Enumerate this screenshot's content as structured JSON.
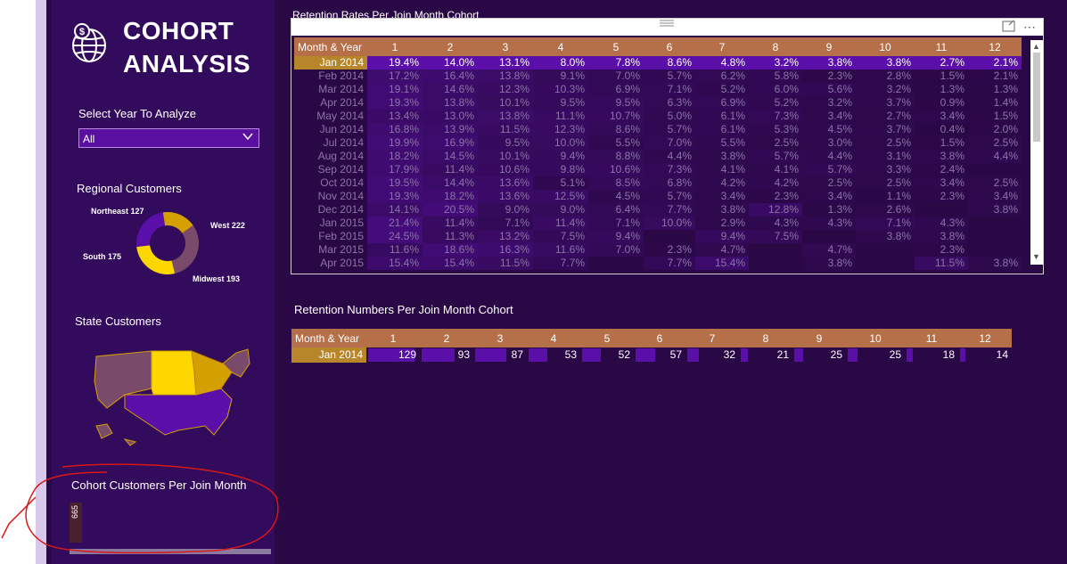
{
  "header": {
    "title_line1": "COHORT",
    "title_line2": "ANALYSIS"
  },
  "slicer": {
    "label": "Select Year To Analyze",
    "value": "All"
  },
  "regional": {
    "title": "Regional Customers",
    "segments": [
      {
        "name": "Northeast",
        "value": 127,
        "label": "Northeast 127",
        "color": "#d4a000"
      },
      {
        "name": "West",
        "value": 222,
        "label": "West 222",
        "color": "#7a4a6a"
      },
      {
        "name": "Midwest",
        "value": 193,
        "label": "Midwest 193",
        "color": "#ffd700"
      },
      {
        "name": "South",
        "value": 175,
        "label": "South 175",
        "color": "#5a10a8"
      }
    ]
  },
  "state": {
    "title": "State Customers"
  },
  "cohort": {
    "title": "Cohort Customers Per Join Month",
    "bar_value": 665,
    "bar_label": "665"
  },
  "matrix1": {
    "title": "Retention Rates Per Join Month Cohort",
    "row_header": "Month & Year",
    "columns": [
      "1",
      "2",
      "3",
      "4",
      "5",
      "6",
      "7",
      "8",
      "9",
      "10",
      "11",
      "12"
    ],
    "rows": [
      {
        "label": "Jan 2014",
        "cells": [
          "19.4%",
          "14.0%",
          "13.1%",
          "8.0%",
          "7.8%",
          "8.6%",
          "4.8%",
          "3.2%",
          "3.8%",
          "3.8%",
          "2.7%",
          "2.1%"
        ]
      },
      {
        "label": "Feb 2014",
        "cells": [
          "17.2%",
          "16.4%",
          "13.8%",
          "9.1%",
          "7.0%",
          "5.7%",
          "6.2%",
          "5.8%",
          "2.3%",
          "2.8%",
          "1.5%",
          "2.1%"
        ]
      },
      {
        "label": "Mar 2014",
        "cells": [
          "19.1%",
          "14.6%",
          "12.3%",
          "10.3%",
          "6.9%",
          "7.1%",
          "5.2%",
          "6.0%",
          "5.6%",
          "3.2%",
          "1.3%",
          "1.3%"
        ]
      },
      {
        "label": "Apr 2014",
        "cells": [
          "19.3%",
          "13.8%",
          "10.1%",
          "9.5%",
          "9.5%",
          "6.3%",
          "6.9%",
          "5.2%",
          "3.2%",
          "3.7%",
          "0.9%",
          "1.4%"
        ]
      },
      {
        "label": "May 2014",
        "cells": [
          "13.4%",
          "13.0%",
          "13.8%",
          "11.1%",
          "10.7%",
          "5.0%",
          "6.1%",
          "7.3%",
          "3.4%",
          "2.7%",
          "3.4%",
          "1.5%"
        ]
      },
      {
        "label": "Jun 2014",
        "cells": [
          "16.8%",
          "13.9%",
          "11.5%",
          "12.3%",
          "8.6%",
          "5.7%",
          "6.1%",
          "5.3%",
          "4.5%",
          "3.7%",
          "0.4%",
          "2.0%"
        ]
      },
      {
        "label": "Jul 2014",
        "cells": [
          "19.9%",
          "16.9%",
          "9.5%",
          "10.0%",
          "5.5%",
          "7.0%",
          "5.5%",
          "2.5%",
          "3.0%",
          "2.5%",
          "1.5%",
          "2.5%"
        ]
      },
      {
        "label": "Aug 2014",
        "cells": [
          "18.2%",
          "14.5%",
          "10.1%",
          "9.4%",
          "8.8%",
          "4.4%",
          "3.8%",
          "5.7%",
          "4.4%",
          "3.1%",
          "3.8%",
          "4.4%"
        ]
      },
      {
        "label": "Sep 2014",
        "cells": [
          "17.9%",
          "11.4%",
          "10.6%",
          "9.8%",
          "10.6%",
          "7.3%",
          "4.1%",
          "4.1%",
          "5.7%",
          "3.3%",
          "2.4%",
          ""
        ]
      },
      {
        "label": "Oct 2014",
        "cells": [
          "19.5%",
          "14.4%",
          "13.6%",
          "5.1%",
          "8.5%",
          "6.8%",
          "4.2%",
          "4.2%",
          "2.5%",
          "2.5%",
          "3.4%",
          "2.5%"
        ]
      },
      {
        "label": "Nov 2014",
        "cells": [
          "19.3%",
          "18.2%",
          "13.6%",
          "12.5%",
          "4.5%",
          "5.7%",
          "3.4%",
          "2.3%",
          "3.4%",
          "1.1%",
          "2.3%",
          "3.4%"
        ]
      },
      {
        "label": "Dec 2014",
        "cells": [
          "14.1%",
          "20.5%",
          "9.0%",
          "9.0%",
          "6.4%",
          "7.7%",
          "3.8%",
          "12.8%",
          "1.3%",
          "2.6%",
          "",
          "3.8%"
        ]
      },
      {
        "label": "Jan 2015",
        "cells": [
          "21.4%",
          "11.4%",
          "7.1%",
          "11.4%",
          "7.1%",
          "10.0%",
          "2.9%",
          "4.3%",
          "4.3%",
          "7.1%",
          "4.3%",
          ""
        ]
      },
      {
        "label": "Feb 2015",
        "cells": [
          "24.5%",
          "11.3%",
          "13.2%",
          "7.5%",
          "9.4%",
          "",
          "9.4%",
          "7.5%",
          "",
          "3.8%",
          "3.8%",
          ""
        ]
      },
      {
        "label": "Mar 2015",
        "cells": [
          "11.6%",
          "18.6%",
          "16.3%",
          "11.6%",
          "7.0%",
          "2.3%",
          "4.7%",
          "",
          "4.7%",
          "",
          "2.3%",
          ""
        ]
      },
      {
        "label": "Apr 2015",
        "cells": [
          "15.4%",
          "15.4%",
          "11.5%",
          "7.7%",
          "",
          "7.7%",
          "15.4%",
          "",
          "3.8%",
          "",
          "11.5%",
          "3.8%"
        ]
      }
    ]
  },
  "matrix2": {
    "title": "Retention Numbers Per Join Month Cohort",
    "row_header": "Month & Year",
    "columns": [
      "1",
      "2",
      "3",
      "4",
      "5",
      "6",
      "7",
      "8",
      "9",
      "10",
      "11",
      "12"
    ],
    "rows": [
      {
        "label": "Jan 2014",
        "cells": [
          129,
          93,
          87,
          53,
          52,
          57,
          32,
          21,
          25,
          25,
          18,
          14
        ]
      }
    ]
  }
}
